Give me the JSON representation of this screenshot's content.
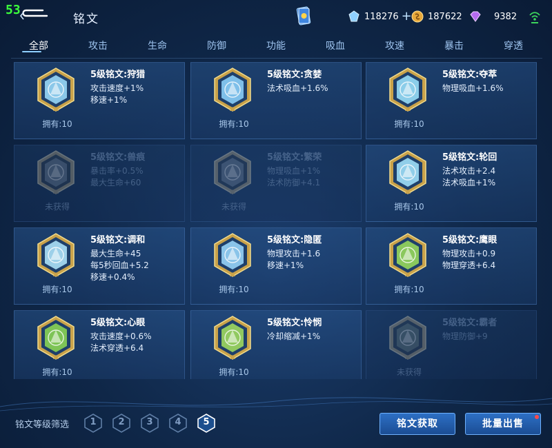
{
  "hud": {
    "fps": "53"
  },
  "header": {
    "title": "铭文"
  },
  "resources": [
    {
      "icon": "diamond-icon",
      "value": "118276",
      "plus": "+"
    },
    {
      "icon": "gold-coin-icon",
      "value": "187622"
    },
    {
      "icon": "gem-icon",
      "value": "9382"
    }
  ],
  "tabs": [
    "全部",
    "攻击",
    "生命",
    "防御",
    "功能",
    "吸血",
    "攻速",
    "暴击",
    "穿透"
  ],
  "active_tab": 0,
  "runes": [
    {
      "name": "5级铭文:狩猎",
      "stats": [
        "攻击速度+1%",
        "移速+1%"
      ],
      "owned": "拥有:10",
      "locked": false,
      "icon": "hunting-rune-icon",
      "color": "#9fe0ff"
    },
    {
      "name": "5级铭文:贪婪",
      "stats": [
        "法术吸血+1.6%"
      ],
      "owned": "拥有:10",
      "locked": false,
      "icon": "greed-rune-icon",
      "color": "#8fd6ff"
    },
    {
      "name": "5级铭文:夺萃",
      "stats": [
        "物理吸血+1.6%"
      ],
      "owned": "拥有:10",
      "locked": false,
      "icon": "extract-rune-icon",
      "color": "#9fe6ff"
    },
    {
      "name": "5级铭文:兽痕",
      "stats": [
        "暴击率+0.5%",
        "最大生命+60"
      ],
      "owned": "未获得",
      "locked": true,
      "icon": "beast-mark-rune-icon",
      "color": "#6b8fb8"
    },
    {
      "name": "5级铭文:繁荣",
      "stats": [
        "物理吸血+1%",
        "法术防御+4.1"
      ],
      "owned": "未获得",
      "locked": true,
      "icon": "prosperity-rune-icon",
      "color": "#6b8fb8"
    },
    {
      "name": "5级铭文:轮回",
      "stats": [
        "法术攻击+2.4",
        "法术吸血+1%"
      ],
      "owned": "拥有:10",
      "locked": false,
      "icon": "cycle-rune-icon",
      "color": "#a6e8ff"
    },
    {
      "name": "5级铭文:调和",
      "stats": [
        "最大生命+45",
        "每5秒回血+5.2",
        "移速+0.4%"
      ],
      "owned": "拥有:10",
      "locked": false,
      "icon": "harmony-rune-icon",
      "color": "#b4eaff"
    },
    {
      "name": "5级铭文:隐匿",
      "stats": [
        "物理攻击+1.6",
        "移速+1%"
      ],
      "owned": "拥有:10",
      "locked": false,
      "icon": "stealth-rune-icon",
      "color": "#9ddcff"
    },
    {
      "name": "5级铭文:鹰眼",
      "stats": [
        "物理攻击+0.9",
        "物理穿透+6.4"
      ],
      "owned": "拥有:10",
      "locked": false,
      "icon": "eagle-eye-rune-icon",
      "color": "#9ee05a"
    },
    {
      "name": "5级铭文:心眼",
      "stats": [
        "攻击速度+0.6%",
        "法术穿透+6.4"
      ],
      "owned": "拥有:10",
      "locked": false,
      "icon": "mind-eye-rune-icon",
      "color": "#8fdc52"
    },
    {
      "name": "5级铭文:怜悯",
      "stats": [
        "冷却缩减+1%"
      ],
      "owned": "拥有:10",
      "locked": false,
      "icon": "mercy-rune-icon",
      "color": "#a6e25e"
    },
    {
      "name": "5级铭文:霸者",
      "stats": [
        "物理防御+9"
      ],
      "owned": "未获得",
      "locked": true,
      "icon": "overlord-rune-icon",
      "color": "#5f8a7a"
    }
  ],
  "filter": {
    "label": "铭文等级筛选",
    "levels": [
      "1",
      "2",
      "3",
      "4",
      "5"
    ],
    "active_level": "5"
  },
  "buttons": {
    "get": "铭文获取",
    "sell": "批量出售"
  },
  "colors": {
    "accent": "#6fb2ff",
    "background": "#0f2748",
    "locked_text": "#6b87ad"
  }
}
